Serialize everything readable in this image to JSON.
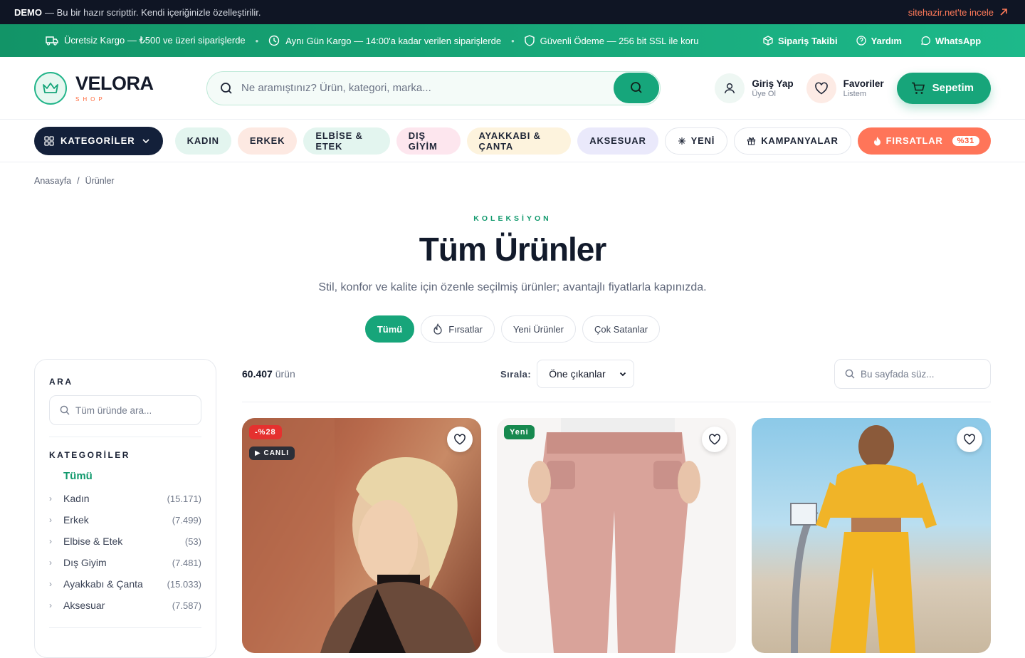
{
  "demo_bar": {
    "brand": "DEMO",
    "text": "— Bu bir hazır scripttir. Kendi içeriğinizle özelleştirilir.",
    "link": "sitehazir.net'te incele"
  },
  "promo_bar": {
    "messages": [
      "Ücretsiz Kargo — ₺500 ve üzeri siparişlerde",
      "Aynı Gün Kargo — 14:00'a kadar verilen siparişlerde",
      "Güvenli Ödeme — 256 bit SSL ile koru"
    ],
    "links": [
      "Sipariş Takibi",
      "Yardım",
      "WhatsApp"
    ]
  },
  "header": {
    "logo_name": "VELORA",
    "logo_sub": "SHOP",
    "search_placeholder": "Ne aramıştınız? Ürün, kategori, marka...",
    "login": {
      "title": "Giriş Yap",
      "sub": "Üye Ol"
    },
    "favorites": {
      "title": "Favoriler",
      "sub": "Listem"
    },
    "cart_label": "Sepetim"
  },
  "nav": {
    "categories_label": "KATEGORİLER",
    "pills": [
      "KADIN",
      "ERKEK",
      "ELBİSE & ETEK",
      "DIŞ GİYİM",
      "AYAKKABI & ÇANTA",
      "AKSESUAR",
      "YENİ",
      "KAMPANYALAR"
    ],
    "deals_label": "FIRSATLAR",
    "deals_badge": "%31"
  },
  "breadcrumb": [
    "Anasayfa",
    "Ürünler"
  ],
  "hero": {
    "kicker": "KOLEKSİYON",
    "title": "Tüm Ürünler",
    "subtitle": "Stil, konfor ve kalite için özenle seçilmiş ürünler; avantajlı fiyatlarla kapınızda."
  },
  "tabs": [
    "Tümü",
    "Fırsatlar",
    "Yeni Ürünler",
    "Çok Satanlar"
  ],
  "sidebar": {
    "search_heading": "ARA",
    "search_placeholder": "Tüm üründe ara...",
    "categories_heading": "KATEGORİLER",
    "all_label": "Tümü",
    "categories": [
      {
        "name": "Kadın",
        "count": "(15.171)"
      },
      {
        "name": "Erkek",
        "count": "(7.499)"
      },
      {
        "name": "Elbise & Etek",
        "count": "(53)"
      },
      {
        "name": "Dış Giyim",
        "count": "(7.481)"
      },
      {
        "name": "Ayakkabı & Çanta",
        "count": "(15.033)"
      },
      {
        "name": "Aksesuar",
        "count": "(7.587)"
      }
    ]
  },
  "toolbar": {
    "count": "60.407",
    "count_unit": "ürün",
    "sort_label": "Sırala:",
    "sort_value": "Öne çıkanlar",
    "filter_placeholder": "Bu sayfada süz..."
  },
  "products": [
    {
      "discount": "-%28",
      "live": "CANLI"
    },
    {
      "badge": "Yeni"
    },
    {}
  ],
  "colors": {
    "primary": "#17a57a",
    "dark": "#0f1524",
    "accent": "#ff7559"
  }
}
